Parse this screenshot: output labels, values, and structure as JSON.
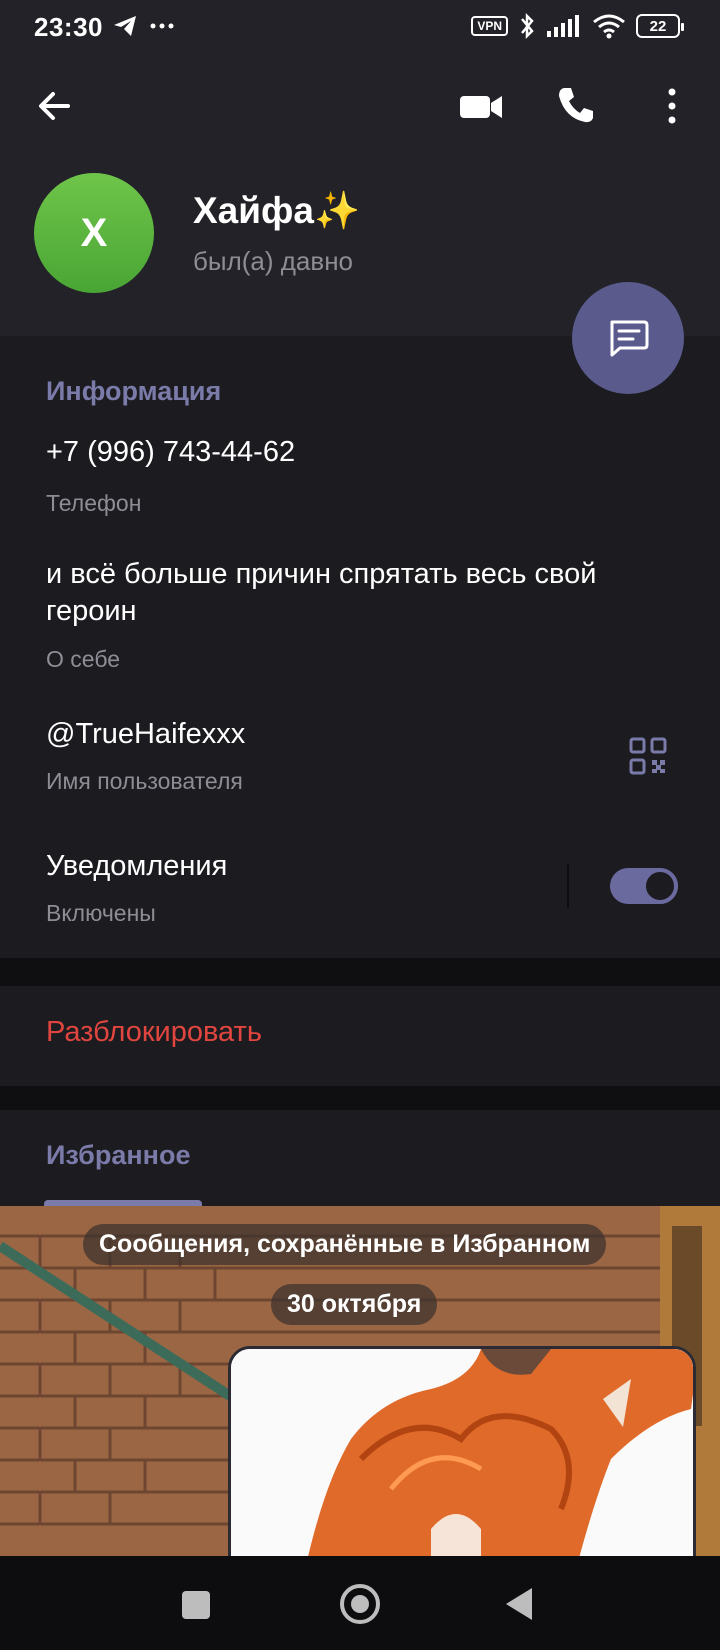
{
  "status_bar": {
    "time": "23:30",
    "vpn": "VPN",
    "battery": "22"
  },
  "profile": {
    "avatar_letter": "Х",
    "name": "Хайфа",
    "name_emoji": "✨",
    "status": "был(а) давно"
  },
  "info": {
    "title": "Информация",
    "phone": {
      "value": "+7 (996) 743-44-62",
      "label": "Телефон"
    },
    "bio": {
      "value": "и всё больше причин спрятать весь свой героин",
      "label": "О себе"
    },
    "username": {
      "value": "@TrueHaifexxx",
      "label": "Имя пользователя"
    },
    "notifications": {
      "value": "Уведомления",
      "label": "Включены",
      "enabled": true
    }
  },
  "actions": {
    "unblock": "Разблокировать"
  },
  "favorites": {
    "title": "Избранное",
    "banner": "Сообщения, сохранённые в Избранном",
    "date": "30 октября"
  },
  "colors": {
    "accent": "#7b7baa",
    "danger": "#e0463f",
    "avatar": "#5cb83e",
    "fab": "#5a5a8c"
  },
  "icons": [
    "back-arrow-icon",
    "video-camera-icon",
    "phone-icon",
    "more-vertical-icon",
    "message-icon",
    "qr-code-icon",
    "telegram-icon",
    "bluetooth-icon",
    "signal-icon",
    "wifi-icon"
  ]
}
